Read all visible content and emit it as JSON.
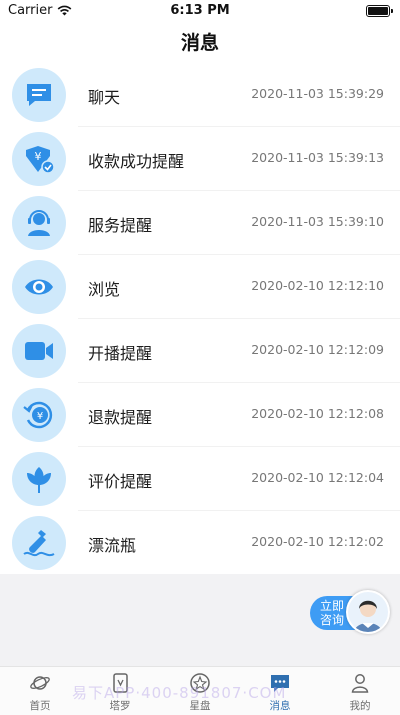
{
  "status_bar": {
    "carrier": "Carrier",
    "time": "6:13 PM"
  },
  "header": {
    "title": "消息"
  },
  "colors": {
    "accent": "#3e9cf4",
    "icon_bg": "#cfe9fb",
    "icon_fg": "#2f8fe6"
  },
  "messages": [
    {
      "icon": "chat-icon",
      "title": "聊天",
      "time": "2020-11-03 15:39:29"
    },
    {
      "icon": "payment-icon",
      "title": "收款成功提醒",
      "time": "2020-11-03 15:39:13"
    },
    {
      "icon": "customer-service-icon",
      "title": "服务提醒",
      "time": "2020-11-03 15:39:10"
    },
    {
      "icon": "eye-icon",
      "title": "浏览",
      "time": "2020-02-10 12:12:10"
    },
    {
      "icon": "video-camera-icon",
      "title": "开播提醒",
      "time": "2020-02-10 12:12:09"
    },
    {
      "icon": "refund-icon",
      "title": "退款提醒",
      "time": "2020-02-10 12:12:08"
    },
    {
      "icon": "lotus-icon",
      "title": "评价提醒",
      "time": "2020-02-10 12:12:04"
    },
    {
      "icon": "drift-bottle-icon",
      "title": "漂流瓶",
      "time": "2020-02-10 12:12:02"
    }
  ],
  "consult": {
    "line1": "立即",
    "line2": "咨询"
  },
  "tabs": [
    {
      "icon": "planet-icon",
      "label": "首页"
    },
    {
      "icon": "tarot-card-icon",
      "label": "塔罗"
    },
    {
      "icon": "astrolabe-icon",
      "label": "星盘"
    },
    {
      "icon": "message-icon",
      "label": "消息",
      "active": true
    },
    {
      "icon": "person-icon",
      "label": "我的"
    }
  ],
  "watermark": "易下APP·400-891807·COM"
}
